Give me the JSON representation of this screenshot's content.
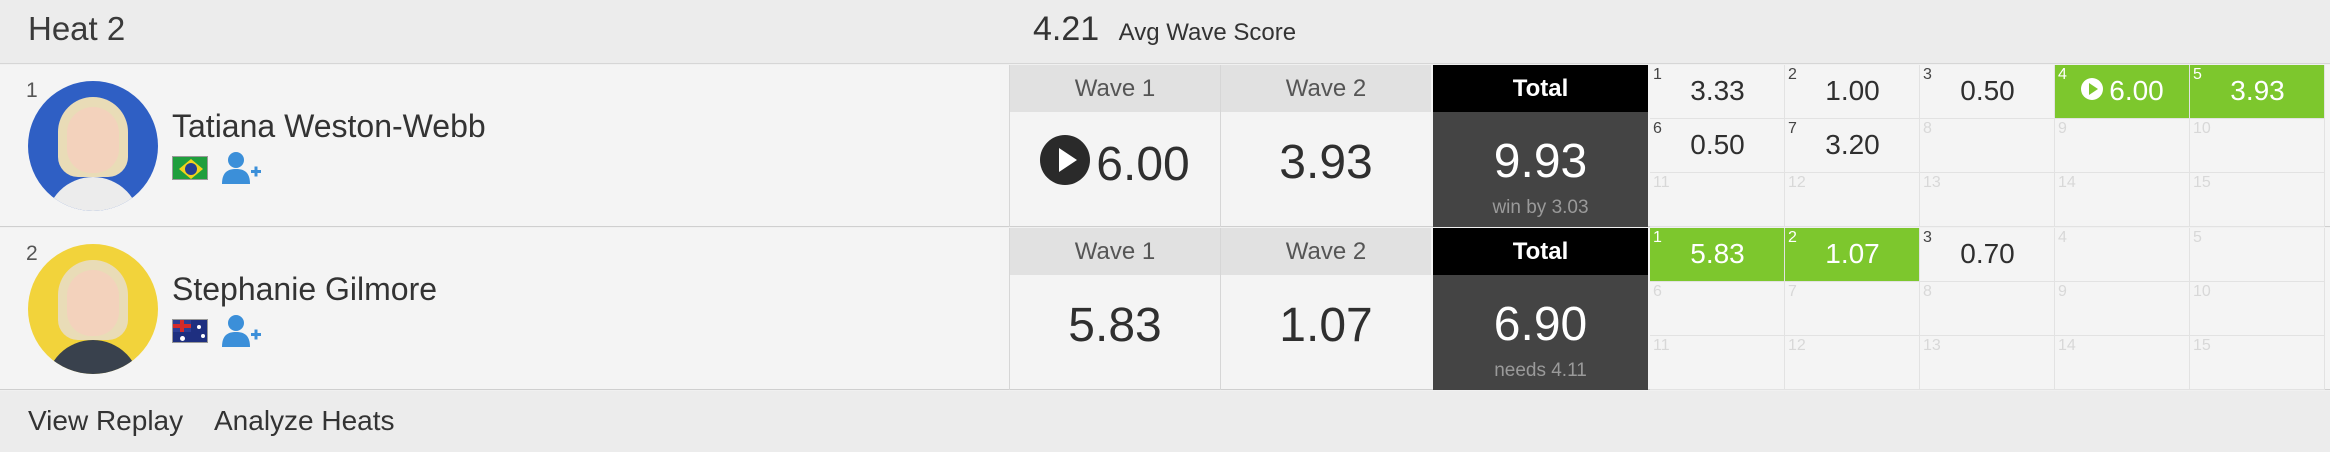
{
  "heat": {
    "title": "Heat 2",
    "avg_score": "4.21",
    "avg_label": "Avg Wave Score"
  },
  "athletes": [
    {
      "seed": "1",
      "name": "Tatiana Weston-Webb",
      "country_flag": "brazil-flag",
      "wave1_label": "Wave 1",
      "wave1_score": "6.00",
      "wave2_label": "Wave 2",
      "wave2_score": "3.93",
      "total_label": "Total",
      "total": "9.93",
      "total_note": "win by 3.03",
      "waves": [
        {
          "n": "1",
          "score": "3.33"
        },
        {
          "n": "2",
          "score": "1.00"
        },
        {
          "n": "3",
          "score": "0.50"
        },
        {
          "n": "4",
          "score": "6.00",
          "counting": true,
          "replay": true
        },
        {
          "n": "5",
          "score": "3.93",
          "counting": true
        },
        {
          "n": "6",
          "score": "0.50"
        },
        {
          "n": "7",
          "score": "3.20"
        },
        {
          "n": "8",
          "score": ""
        },
        {
          "n": "9",
          "score": ""
        },
        {
          "n": "10",
          "score": ""
        },
        {
          "n": "11",
          "score": ""
        },
        {
          "n": "12",
          "score": ""
        },
        {
          "n": "13",
          "score": ""
        },
        {
          "n": "14",
          "score": ""
        },
        {
          "n": "15",
          "score": ""
        }
      ]
    },
    {
      "seed": "2",
      "name": "Stephanie Gilmore",
      "country_flag": "australia-flag",
      "wave1_label": "Wave 1",
      "wave1_score": "5.83",
      "wave2_label": "Wave 2",
      "wave2_score": "1.07",
      "total_label": "Total",
      "total": "6.90",
      "total_note": "needs 4.11",
      "waves": [
        {
          "n": "1",
          "score": "5.83",
          "counting": true
        },
        {
          "n": "2",
          "score": "1.07",
          "counting": true
        },
        {
          "n": "3",
          "score": "0.70"
        },
        {
          "n": "4",
          "score": ""
        },
        {
          "n": "5",
          "score": ""
        },
        {
          "n": "6",
          "score": ""
        },
        {
          "n": "7",
          "score": ""
        },
        {
          "n": "8",
          "score": ""
        },
        {
          "n": "9",
          "score": ""
        },
        {
          "n": "10",
          "score": ""
        },
        {
          "n": "11",
          "score": ""
        },
        {
          "n": "12",
          "score": ""
        },
        {
          "n": "13",
          "score": ""
        },
        {
          "n": "14",
          "score": ""
        },
        {
          "n": "15",
          "score": ""
        }
      ]
    }
  ],
  "footer": {
    "replay_label": "View Replay",
    "analyze_label": "Analyze Heats"
  },
  "colors": {
    "counting_wave": "#7dc72d",
    "total_bg": "#444444",
    "total_header": "#000000",
    "follow_icon": "#3b8fd9"
  }
}
